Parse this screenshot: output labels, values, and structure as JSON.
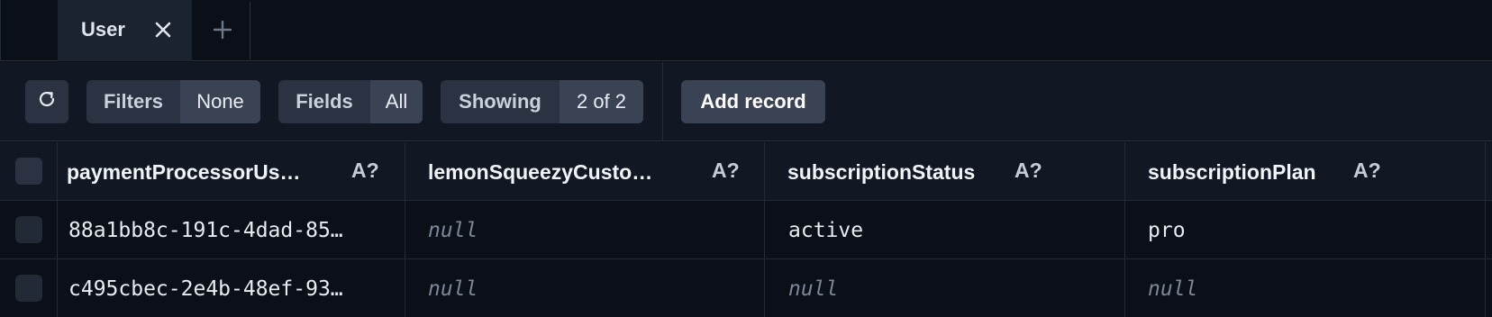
{
  "tabs": {
    "active_label": "User",
    "close_icon": "close-icon",
    "add_icon": "plus-icon"
  },
  "toolbar": {
    "refresh_icon": "refresh-icon",
    "filters_label": "Filters",
    "filters_value": "None",
    "fields_label": "Fields",
    "fields_value": "All",
    "showing_label": "Showing",
    "showing_value": "2 of 2",
    "add_record_label": "Add record"
  },
  "table": {
    "columns": [
      {
        "label": "paymentProcessorUs…",
        "type": "A?"
      },
      {
        "label": "lemonSqueezyCusto…",
        "type": "A?"
      },
      {
        "label": "subscriptionStatus",
        "type": "A?"
      },
      {
        "label": "subscriptionPlan",
        "type": "A?"
      }
    ],
    "rows": [
      {
        "cells": [
          "88a1bb8c-191c-4dad-85…",
          "null",
          "active",
          "pro"
        ]
      },
      {
        "cells": [
          "c495cbec-2e4b-48ef-93…",
          "null",
          "null",
          "null"
        ]
      }
    ]
  },
  "colors": {
    "background": "#0b0f17",
    "toolbar": "#121823",
    "button": "#2b3342",
    "button_value": "#3a4354",
    "null_text": "#7e8797"
  }
}
